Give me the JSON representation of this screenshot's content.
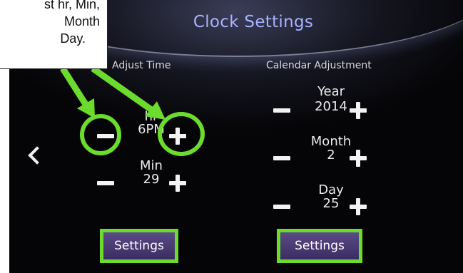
{
  "screen": {
    "title": "Clock Settings",
    "adjust_time": {
      "label": "Adjust Time",
      "hour": {
        "label": "hr",
        "value": "6PM"
      },
      "minute": {
        "label": "Min",
        "value": "29"
      },
      "settings_label": "Settings"
    },
    "calendar": {
      "label": "Calendar Adjustment",
      "year": {
        "label": "Year",
        "value": "2014"
      },
      "month": {
        "label": "Month",
        "value": "2"
      },
      "day": {
        "label": "Day",
        "value": "25"
      },
      "settings_label": "Settings"
    }
  },
  "annotation": {
    "line1": "st hr, Min,",
    "line2": "Month",
    "line3": "Day.",
    "highlight_color": "#6bdc2e"
  }
}
